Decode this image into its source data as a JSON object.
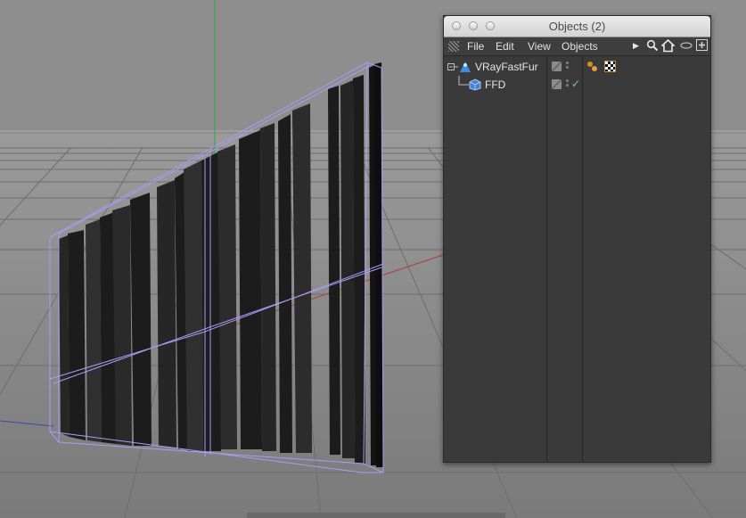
{
  "window": {
    "title": "Objects (2)"
  },
  "menu": {
    "file": "File",
    "edit": "Edit",
    "view": "View",
    "objects": "Objects"
  },
  "toolbar": {
    "icons": [
      "play-triangle-icon",
      "search-icon",
      "home-icon",
      "eye-icon",
      "new-window-icon"
    ]
  },
  "objects": [
    {
      "name": "VRayFastFur",
      "icon": "vray-fastfur-icon",
      "expanded": true,
      "tags": [
        "material-tag-icon",
        "checker-texture-tag-icon"
      ]
    },
    {
      "name": "FFD",
      "icon": "ffd-deformer-icon",
      "enabled": true
    }
  ],
  "colors": {
    "viewport_bg": "#8a8a8a",
    "panel_bg": "#3a3a3a",
    "selection_box": "#9a8cff"
  }
}
